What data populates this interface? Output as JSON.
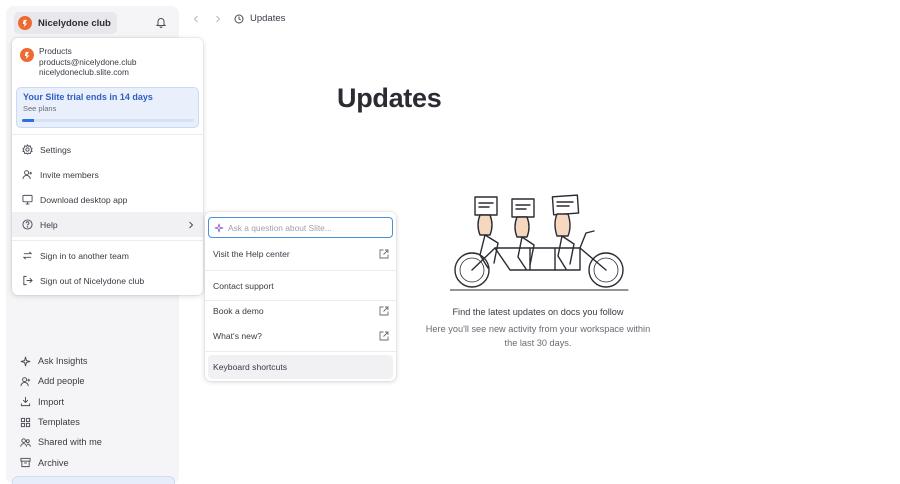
{
  "workspace": {
    "name": "Nicelydone club",
    "logo_color": "#ef6a32",
    "icon": "slite-logo-icon",
    "notifications_icon": "bell-icon"
  },
  "sidebar": {
    "items": [
      {
        "label": "Ask Insights",
        "icon": "sparkle-icon"
      },
      {
        "label": "Add people",
        "icon": "user-plus-icon"
      },
      {
        "label": "Import",
        "icon": "import-icon"
      },
      {
        "label": "Templates",
        "icon": "templates-icon"
      },
      {
        "label": "Shared with me",
        "icon": "shared-icon"
      },
      {
        "label": "Archive",
        "icon": "archive-icon"
      }
    ]
  },
  "topbar": {
    "back_icon": "chevron-left-icon",
    "forward_icon": "chevron-right-icon",
    "breadcrumb": "Updates",
    "breadcrumb_icon": "clock-icon"
  },
  "main": {
    "title": "Updates",
    "empty_title": "Find the latest updates on docs you follow",
    "empty_subtitle": "Here you'll see new activity from your workspace within the last 30 days."
  },
  "workspace_menu": {
    "account": {
      "name": "Products",
      "email": "products@nicelydone.club",
      "domain": "nicelydoneclub.slite.com"
    },
    "trial": {
      "title": "Your Slite trial ends in 14 days",
      "link": "See plans",
      "progress": 0.07,
      "accent": "#2f6fe4"
    },
    "items": [
      {
        "label": "Settings",
        "icon": "gear-icon"
      },
      {
        "label": "Invite members",
        "icon": "user-plus-icon"
      },
      {
        "label": "Download desktop app",
        "icon": "monitor-icon"
      },
      {
        "label": "Help",
        "icon": "help-circle-icon"
      },
      {
        "label": "Sign in to another team",
        "icon": "switch-icon"
      },
      {
        "label": "Sign out of Nicelydone club",
        "icon": "sign-out-icon"
      }
    ]
  },
  "help_menu": {
    "search_placeholder": "Ask a question about Slite...",
    "search_value": "",
    "items": [
      {
        "label": "Visit the Help center",
        "external": true
      },
      {
        "label": "Contact support",
        "external": false
      },
      {
        "label": "Book a demo",
        "external": true
      },
      {
        "label": "What's new?",
        "external": true
      },
      {
        "label": "Keyboard shortcuts",
        "external": false
      }
    ]
  }
}
